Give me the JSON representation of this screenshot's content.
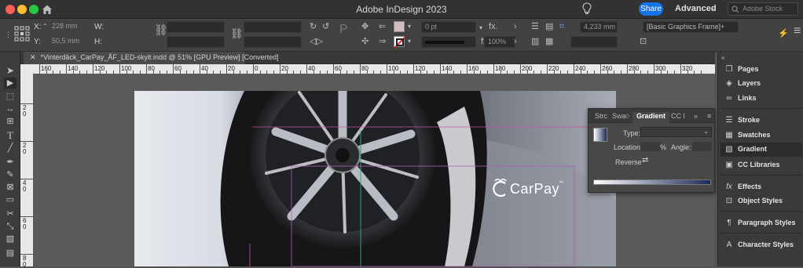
{
  "window": {
    "title": "Adobe InDesign 2023",
    "share_label": "Share",
    "workspace_label": "Advanced",
    "search_placeholder": "Adobe Stock"
  },
  "control": {
    "x_label": "X:",
    "x_value": "228 mm",
    "y_label": "Y:",
    "y_value": "50,5 mm",
    "w_label": "W:",
    "h_label": "H:",
    "stroke_weight": "0 pt",
    "opacity": "100%",
    "fx_label": "fx.",
    "gap_value": "4,233 mm",
    "object_style": "[Basic Graphics Frame]+"
  },
  "document": {
    "tab_title": "*Vinterdäck_CarPay_ÅF_LED-skylt.indd @ 51% [GPU Preview] [Converted]"
  },
  "ruler": {
    "h_labels": [
      "160",
      "140",
      "120",
      "100",
      "80",
      "60",
      "40",
      "20",
      "0",
      "20",
      "40",
      "60",
      "80",
      "100",
      "120",
      "140",
      "160",
      "180",
      "200",
      "220",
      "240",
      "260",
      "280",
      "300",
      "320"
    ],
    "v_labels": [
      "2 0",
      "2 0",
      "4 0",
      "6 0",
      "8 0"
    ]
  },
  "canvas": {
    "logo_text": "CarPay",
    "logo_tm": "™"
  },
  "gradient_panel": {
    "tabs": [
      "Strc",
      "Swa",
      "Gradient",
      "CC l"
    ],
    "type_label": "Type:",
    "location_label": "Location:",
    "percent_symbol": "%",
    "angle_label": "Angle:",
    "reverse_label": "Reverse"
  },
  "dock": {
    "items": [
      "Pages",
      "Layers",
      "Links",
      "Stroke",
      "Swatches",
      "Gradient",
      "CC Libraries",
      "Effects",
      "Object Styles",
      "Paragraph Styles",
      "Character Styles"
    ],
    "fx_glyph": "fx"
  },
  "colors": {
    "accent": "#1473e6",
    "chrome": "#323232",
    "panel": "#484848",
    "fill_swatch": "#d4bcc0",
    "stroke_swatch": "#e02020"
  }
}
